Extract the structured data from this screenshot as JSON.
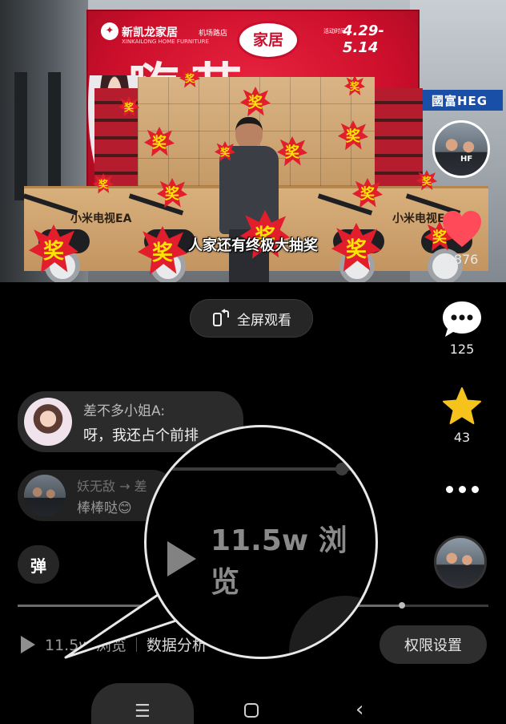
{
  "video": {
    "brand_name": "新凯龙家居",
    "brand_sub": "XINKAILONG HOME FURNITURE",
    "brand_place": "机场路店",
    "bubble_label": "家居",
    "event_label": "活动时间",
    "event_dates": "4.29-5.14",
    "banner_big_text": "嗨        节",
    "store_sign": "國富HEG",
    "counter_label_1": "小米电视EA",
    "counter_label_2": "小米电视EA",
    "prize_glyph": "奖",
    "caption": "人家还有终极大抽奖"
  },
  "rail": {
    "like_count": "1876",
    "comment_count": "125",
    "favorite_count": "43",
    "hf_badge": "HF",
    "like_color": "#ff4a5a",
    "favorite_color": "#f6c21c"
  },
  "fullscreen": {
    "label": "全屏观看"
  },
  "comments": [
    {
      "name": "差不多小姐A:",
      "text": "呀，我还占个前排"
    },
    {
      "name": "妖无敌 → 差",
      "text": "棒棒哒😊"
    }
  ],
  "danmu": {
    "label": "弹"
  },
  "progress": {
    "percent": 81
  },
  "bottom": {
    "views": "11.5w 浏览",
    "data_analysis": "数据分析",
    "permission": "权限设置"
  },
  "magnifier": {
    "views": "11.5w 浏览"
  },
  "icons": {
    "play": "play-icon",
    "heart": "heart-icon",
    "comment": "comment-icon",
    "star": "star-icon",
    "more": "more-icon",
    "fullscreen": "rotate-screen-icon"
  }
}
